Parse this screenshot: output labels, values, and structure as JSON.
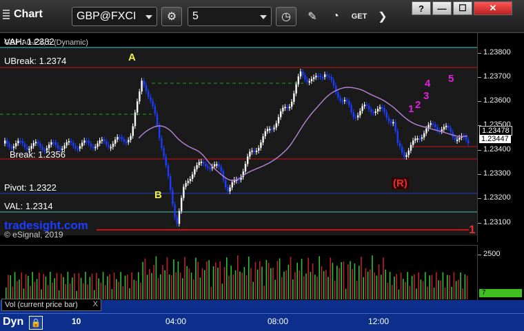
{
  "toolbar": {
    "title": "Chart",
    "symbol": "GBP@FXCI",
    "interval": "5",
    "buttons": [
      "gear-icon",
      "clock-icon",
      "pencil-icon",
      "indicator-icon",
      "get-icon",
      "next-icon"
    ],
    "window_buttons": [
      "?",
      "—",
      "☐",
      "✕"
    ]
  },
  "chart": {
    "series_label": "GBP A0-FX, 5 (Dynamic)",
    "levels": {
      "vah": "VAH: 1.2382",
      "ubreak": "UBreak: 1.2374",
      "break": "Break: 1.2356",
      "pivot": "Pivot: 1.2322",
      "val": "VAL: 1.2314"
    },
    "markers": {
      "A": "A",
      "B": "B",
      "R": "(R)",
      "one": "1",
      "two": "2",
      "three": "3",
      "four": "4",
      "five": "5",
      "one_b": "1"
    },
    "watermark": "tradesight.com",
    "copyright": "© eSignal, 2019",
    "price_ticks": [
      "1.23800",
      "1.23700",
      "1.23600",
      "1.23500",
      "1.23400",
      "1.23300",
      "1.23200",
      "1.23100"
    ],
    "price_tags": {
      "ma": "1.23478",
      "last": "1.23447"
    }
  },
  "volume": {
    "label": "Vol (current price bar)",
    "close_label": "X",
    "tick": "2500",
    "current_value": "7"
  },
  "bottom": {
    "dyn": "Dyn",
    "times": [
      "10",
      "04:00",
      "08:00",
      "12:00"
    ]
  },
  "colors": {
    "up_bar": "#ffffff",
    "down_bar": "#1a3dff",
    "ma_line": "#b080d0",
    "level_red": "#d01010",
    "level_blue": "#2040c0",
    "level_cyan": "#40c0c0",
    "level_green": "#20a020",
    "vol_up": "#30c030",
    "vol_down": "#c02020"
  }
}
